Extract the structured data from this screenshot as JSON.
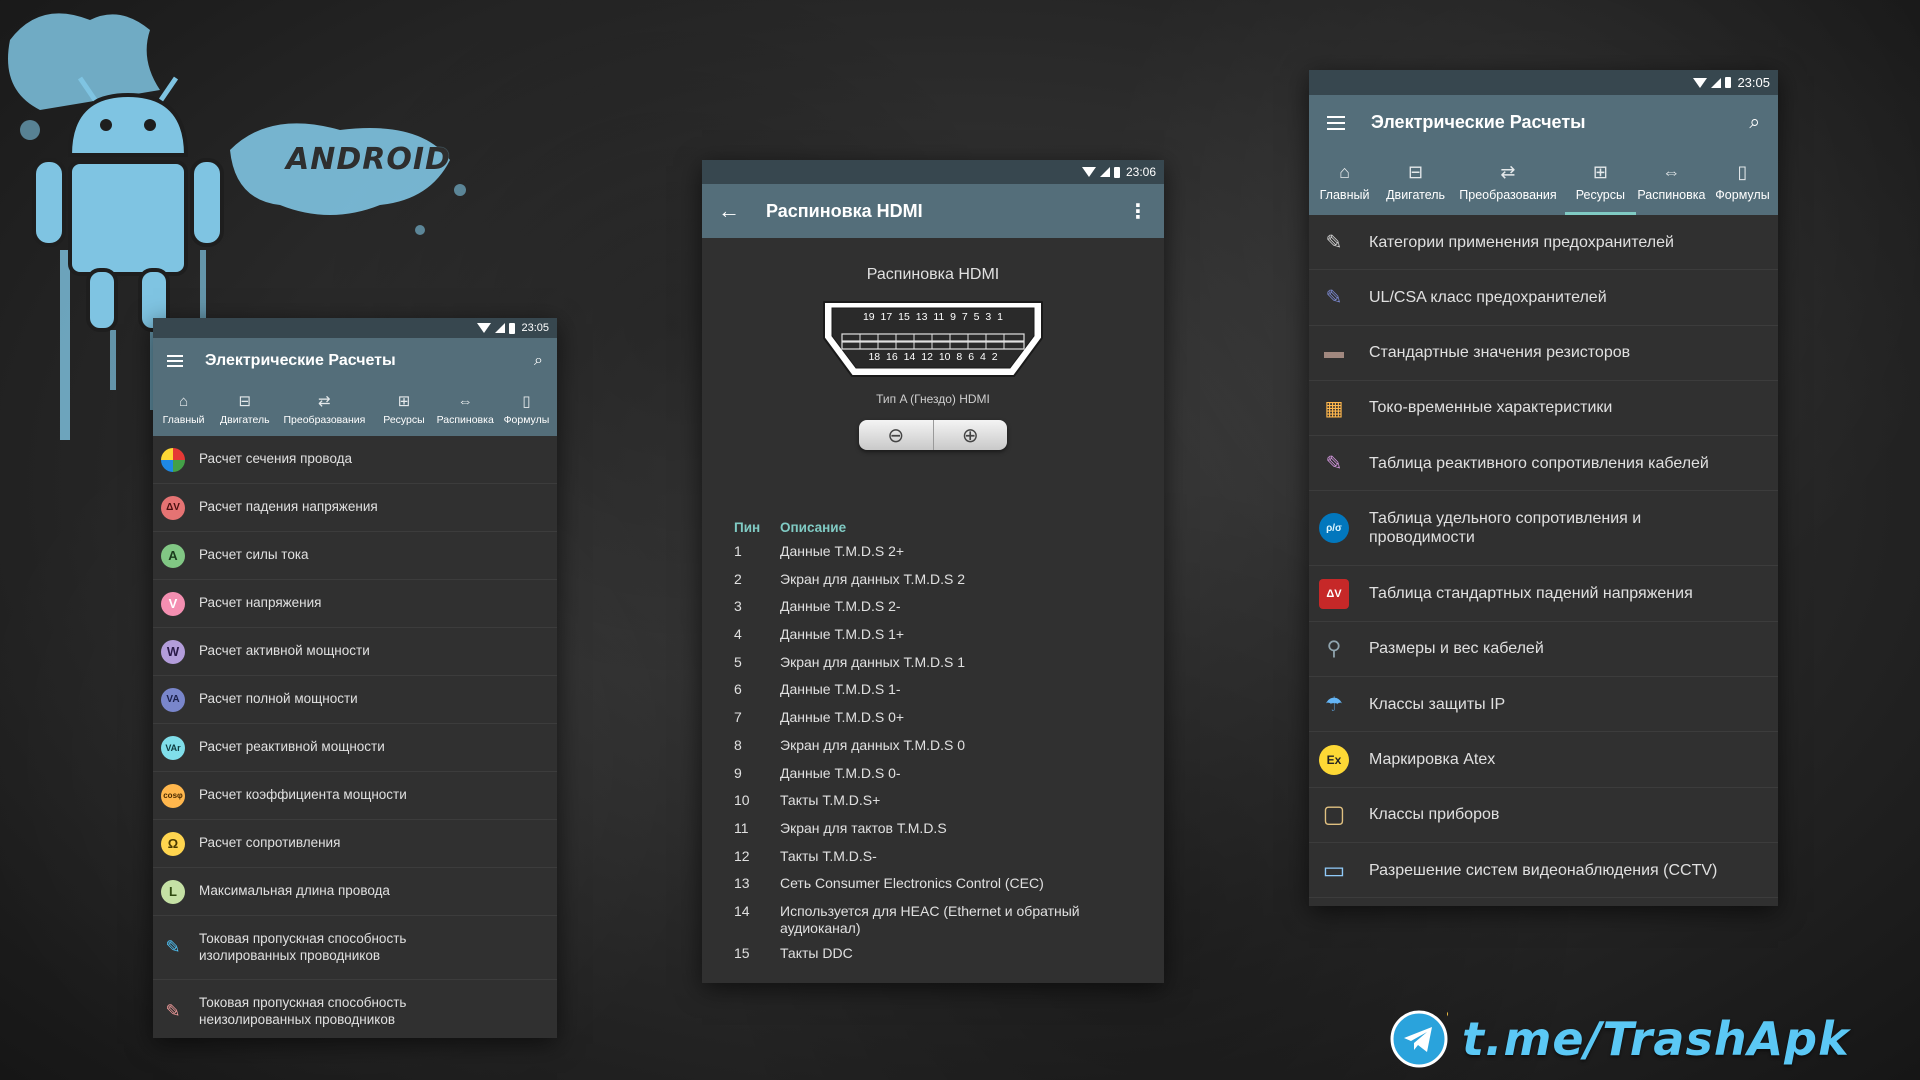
{
  "brand": {
    "android_word": "ANDROID",
    "telegram_handle": "t.me/TrashApk"
  },
  "colors": {
    "appbar": "#546e7a",
    "statusbar": "#37474f",
    "accent": "#80cbc4",
    "splash": "#7fc4e2",
    "telegram": "#5bc8f5"
  },
  "main_screen": {
    "status_time": "23:05",
    "title": "Электрические Расчеты",
    "tabs": [
      {
        "label": "Главный",
        "icon": "home-icon"
      },
      {
        "label": "Двигатель",
        "icon": "motor-icon"
      },
      {
        "label": "Преобразования",
        "icon": "convert-icon"
      },
      {
        "label": "Ресурсы",
        "icon": "table-icon"
      },
      {
        "label": "Распиновка",
        "icon": "pinout-icon"
      },
      {
        "label": "Формулы",
        "icon": "book-icon"
      }
    ],
    "items": [
      "Расчет сечения провода",
      "Расчет падения напряжения",
      "Расчет силы тока",
      "Расчет напряжения",
      "Расчет активной мощности",
      "Расчет полной мощности",
      "Расчет реактивной мощности",
      "Расчет коэффициента мощности",
      "Расчет сопротивления",
      "Максимальная длина провода",
      "Токовая пропускная способность изолированных проводников",
      "Токовая пропускная способность неизолированных проводников"
    ],
    "item_icons": [
      {
        "glyph": "●",
        "color": "#e8e8e8"
      },
      {
        "glyph": "ΔV",
        "color": "#e57373"
      },
      {
        "glyph": "A",
        "color": "#81c784"
      },
      {
        "glyph": "V",
        "color": "#f48fb1"
      },
      {
        "glyph": "W",
        "color": "#b39ddb"
      },
      {
        "glyph": "VA",
        "color": "#7986cb"
      },
      {
        "glyph": "VAr",
        "color": "#80deea"
      },
      {
        "glyph": "cosφ",
        "color": "#ffb74d"
      },
      {
        "glyph": "Ω",
        "color": "#ffd54f"
      },
      {
        "glyph": "L",
        "color": "#c5e1a5"
      },
      {
        "glyph": "✎",
        "color": "#4fc3f7"
      },
      {
        "glyph": "✎",
        "color": "#ef9a9a"
      }
    ]
  },
  "hdmi_screen": {
    "status_time": "23:06",
    "title": "Распиновка HDMI",
    "subtitle": "Распиновка HDMI",
    "connector_top_pins": "19 17 15 13 11 9 7 5 3 1",
    "connector_bottom_pins": "18 16 14 12 10 8 6 4 2",
    "connector_caption": "Тип A (Гнездо) HDMI",
    "table_headers": {
      "pin": "Пин",
      "desc": "Описание"
    },
    "pins": [
      {
        "pin": "1",
        "desc": "Данные T.M.D.S 2+"
      },
      {
        "pin": "2",
        "desc": "Экран для данных T.M.D.S 2"
      },
      {
        "pin": "3",
        "desc": "Данные T.M.D.S 2-"
      },
      {
        "pin": "4",
        "desc": "Данные T.M.D.S 1+"
      },
      {
        "pin": "5",
        "desc": "Экран для данных T.M.D.S 1"
      },
      {
        "pin": "6",
        "desc": "Данные T.M.D.S 1-"
      },
      {
        "pin": "7",
        "desc": "Данные T.M.D.S 0+"
      },
      {
        "pin": "8",
        "desc": "Экран для данных T.M.D.S 0"
      },
      {
        "pin": "9",
        "desc": "Данные T.M.D.S 0-"
      },
      {
        "pin": "10",
        "desc": "Такты T.M.D.S+"
      },
      {
        "pin": "11",
        "desc": "Экран для тактов T.M.D.S"
      },
      {
        "pin": "12",
        "desc": "Такты T.M.D.S-"
      },
      {
        "pin": "13",
        "desc": "Сеть Consumer Electronics Control (CEC)"
      },
      {
        "pin": "14",
        "desc": "Используется для HEAC (Ethernet и обратный аудиоканал)"
      },
      {
        "pin": "15",
        "desc": "Такты DDC"
      }
    ]
  },
  "resources_screen": {
    "status_time": "23:05",
    "title": "Электрические Расчеты",
    "active_tab": "Ресурсы",
    "items": [
      "Категории применения предохранителей",
      "UL/CSA класс предохранителей",
      "Стандартные значения резисторов",
      "Токо-временные характеристики",
      "Таблица реактивного сопротивления кабелей",
      "Таблица удельного сопротивления и проводимости",
      "Таблица стандартных падений напряжения",
      "Размеры и вес кабелей",
      "Классы защиты IP",
      "Маркировка Atex",
      "Классы приборов",
      "Разрешение систем видеонаблюдения (CCTV)"
    ],
    "item_icons": [
      {
        "glyph": "✎",
        "color": "#d0d0d0"
      },
      {
        "glyph": "✎",
        "color": "#7986cb"
      },
      {
        "glyph": "▬",
        "color": "#a1887f"
      },
      {
        "glyph": "▦",
        "color": "#ffb74d"
      },
      {
        "glyph": "✎",
        "color": "#ce93d8"
      },
      {
        "glyph": "ρ/σ",
        "color": "#4fc3f7"
      },
      {
        "glyph": "ΔV",
        "color": "#e57373"
      },
      {
        "glyph": "⚲",
        "color": "#90a4ae"
      },
      {
        "glyph": "☂",
        "color": "#64b5f6"
      },
      {
        "glyph": "Ex",
        "color": "#fdd835"
      },
      {
        "glyph": "▢",
        "color": "#e0c080"
      },
      {
        "glyph": "▭",
        "color": "#90caf9"
      }
    ]
  }
}
